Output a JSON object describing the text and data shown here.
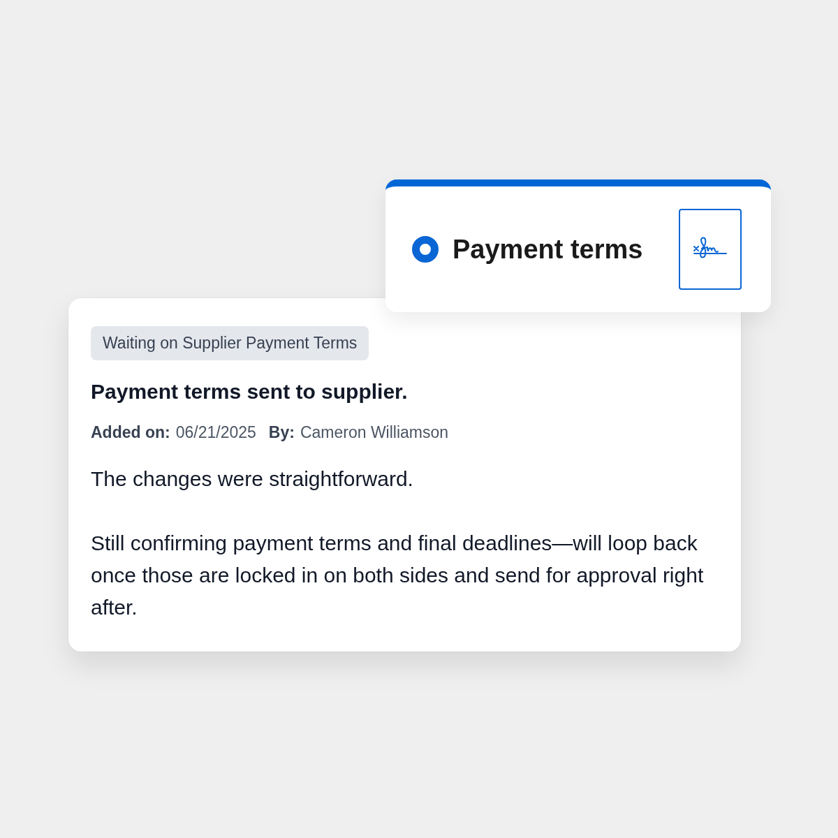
{
  "task_card": {
    "title": "Payment terms",
    "selected": true
  },
  "note": {
    "tag": "Waiting on Supplier Payment Terms",
    "title": "Payment terms sent to supplier.",
    "meta": [
      {
        "label": "Added on:",
        "value": "06/21/2025"
      },
      {
        "label": "By:",
        "value": "Cameron Williamson"
      }
    ],
    "paragraphs": [
      "The changes were straightforward.",
      "Still confirming payment terms and final deadlines—will loop back once those are locked in on both sides and send for approval right after."
    ]
  }
}
